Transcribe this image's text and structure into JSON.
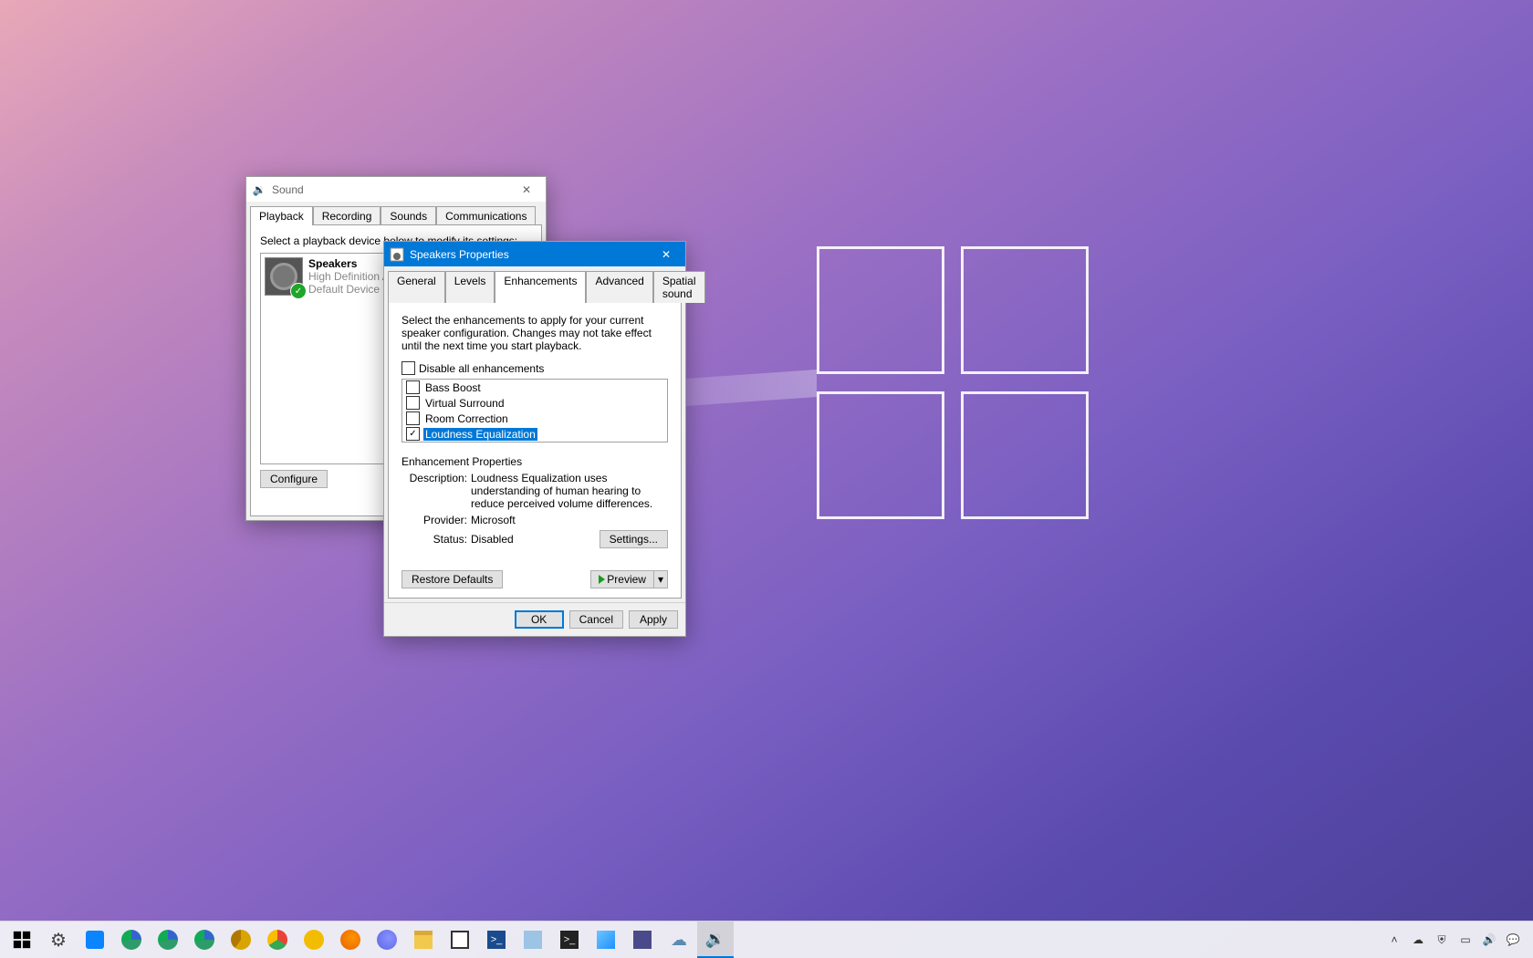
{
  "soundWindow": {
    "title": "Sound",
    "tabs": [
      "Playback",
      "Recording",
      "Sounds",
      "Communications"
    ],
    "selectedTab": 0,
    "instruction": "Select a playback device below to modify its settings:",
    "device": {
      "name": "Speakers",
      "line2": "High Definition Au",
      "line3": "Default Device"
    },
    "configureBtn": "Configure"
  },
  "propsWindow": {
    "title": "Speakers Properties",
    "tabs": [
      "General",
      "Levels",
      "Enhancements",
      "Advanced",
      "Spatial sound"
    ],
    "selectedTab": 2,
    "instruction": "Select the enhancements to apply for your current speaker configuration. Changes may not take effect until the next time you start playback.",
    "disableAll": {
      "label": "Disable all enhancements",
      "checked": false
    },
    "enhancements": [
      {
        "label": "Bass Boost",
        "checked": false,
        "selected": false
      },
      {
        "label": "Virtual Surround",
        "checked": false,
        "selected": false
      },
      {
        "label": "Room Correction",
        "checked": false,
        "selected": false
      },
      {
        "label": "Loudness Equalization",
        "checked": true,
        "selected": true
      }
    ],
    "propertiesHeader": "Enhancement Properties",
    "descLabel": "Description:",
    "descVal": "Loudness Equalization uses understanding of human hearing to reduce perceived volume differences.",
    "providerLabel": "Provider:",
    "providerVal": "Microsoft",
    "statusLabel": "Status:",
    "statusVal": "Disabled",
    "settingsBtn": "Settings...",
    "restoreBtn": "Restore Defaults",
    "previewBtn": "Preview",
    "okBtn": "OK",
    "cancelBtn": "Cancel",
    "applyBtn": "Apply"
  },
  "taskbar": {
    "pinned": [
      {
        "name": "start",
        "color": "#000"
      },
      {
        "name": "settings",
        "color": "#444"
      },
      {
        "name": "phone",
        "color": "#0a84ff"
      },
      {
        "name": "edge",
        "color": "#2e9c6a"
      },
      {
        "name": "edge-beta",
        "color": "#2e9c6a"
      },
      {
        "name": "edge-dev",
        "color": "#2e9c6a"
      },
      {
        "name": "edge-canary",
        "color": "#d9a400"
      },
      {
        "name": "chrome",
        "color": "#ea4335"
      },
      {
        "name": "chrome-canary",
        "color": "#f2bd00"
      },
      {
        "name": "firefox",
        "color": "#e66000"
      },
      {
        "name": "firefox-dev",
        "color": "#5a65e3"
      },
      {
        "name": "file-explorer",
        "color": "#f2c94c"
      },
      {
        "name": "store",
        "color": "#333"
      },
      {
        "name": "powershell",
        "color": "#1a4b8c"
      },
      {
        "name": "devtool",
        "color": "#5aa0d8"
      },
      {
        "name": "terminal",
        "color": "#222"
      },
      {
        "name": "photos",
        "color": "#1e90ff"
      },
      {
        "name": "paint3d",
        "color": "#4a4a8a"
      },
      {
        "name": "onedrive",
        "color": "#93b7d8"
      },
      {
        "name": "sound-cpl",
        "color": "#888"
      }
    ],
    "tray": [
      "chevron-up-icon",
      "cloud-icon",
      "security-icon",
      "cast-icon",
      "volume-icon",
      "action-center-icon"
    ]
  }
}
